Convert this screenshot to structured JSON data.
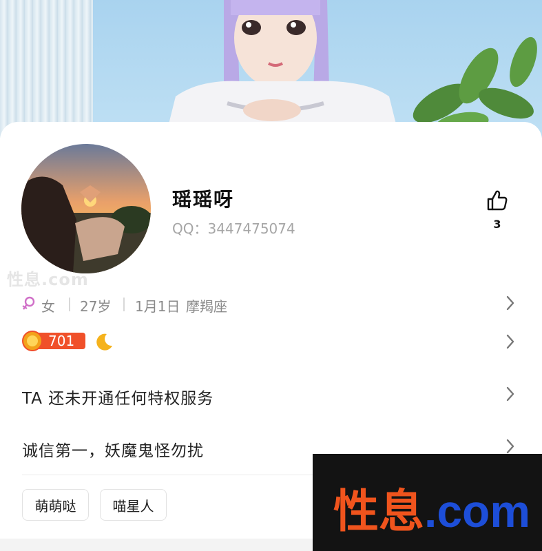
{
  "profile": {
    "name": "瑶瑶呀",
    "qq": "QQ：3447475074",
    "likes": "3"
  },
  "info": {
    "gender": "女",
    "age": "27岁",
    "birthday": "1月1日",
    "zodiac": "摩羯座"
  },
  "level": {
    "value": "701"
  },
  "privilege_text": "TA 还未开通任何特权服务",
  "signature": "诚信第一，妖魔鬼怪勿扰",
  "tags": [
    "萌萌哒",
    "喵星人"
  ],
  "watermark": {
    "cn": "性息",
    "dot": ".com",
    "faint": "性息.com"
  },
  "colors": {
    "gender_icon": "#d070c8",
    "level_badge": "#f0502a",
    "watermark_orange": "#f0541d",
    "watermark_blue": "#1d4ed8"
  }
}
